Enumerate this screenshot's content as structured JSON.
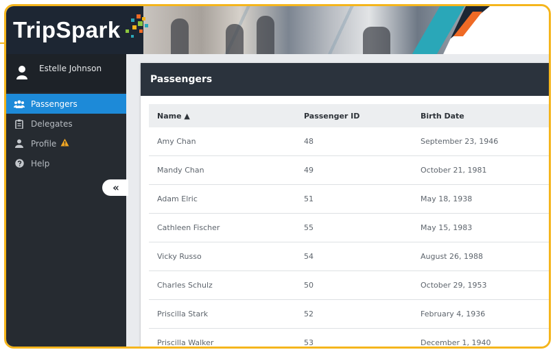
{
  "app": {
    "logo_text": "TripSpark"
  },
  "user": {
    "name": "Estelle Johnson"
  },
  "sidebar": {
    "items": [
      {
        "label": "Passengers",
        "icon": "users-icon",
        "active": true
      },
      {
        "label": "Delegates",
        "icon": "clipboard-icon",
        "active": false
      },
      {
        "label": "Profile",
        "icon": "user-icon",
        "active": false,
        "warning": true
      },
      {
        "label": "Help",
        "icon": "question-icon",
        "active": false
      }
    ],
    "collapse_label": "«"
  },
  "main": {
    "title": "Passengers",
    "columns": [
      "Name ▲",
      "Passenger ID",
      "Birth Date"
    ],
    "rows": [
      [
        "Amy Chan",
        "48",
        "September 23, 1946"
      ],
      [
        "Mandy Chan",
        "49",
        "October 21, 1981"
      ],
      [
        "Adam Elric",
        "51",
        "May 18, 1938"
      ],
      [
        "Cathleen Fischer",
        "55",
        "May 15, 1983"
      ],
      [
        "Vicky Russo",
        "54",
        "August 26, 1988"
      ],
      [
        "Charles Schulz",
        "50",
        "October 29, 1953"
      ],
      [
        "Priscilla Stark",
        "52",
        "February 4, 1936"
      ],
      [
        "Priscilla Walker",
        "53",
        "December 1, 1940"
      ]
    ]
  },
  "colors": {
    "accent": "#1d8ad8",
    "frame": "#f5b51c",
    "sidebar_bg": "#262b31",
    "warning": "#f0a623",
    "stripe_teal": "#2aa7b8",
    "stripe_orange": "#ef6a25"
  }
}
